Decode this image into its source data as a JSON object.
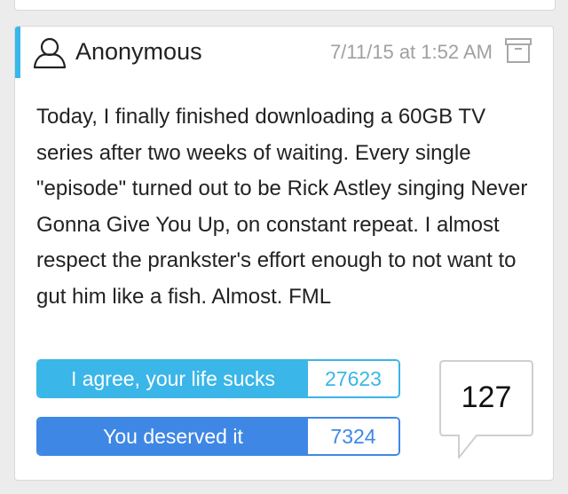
{
  "post": {
    "author": "Anonymous",
    "timestamp": "7/11/15 at 1:52 AM",
    "text": "Today, I finally finished downloading a 60GB TV series after two weeks of waiting. Every single \"episode\" turned out to be Rick Astley singing Never Gonna Give You Up, on constant repeat. I almost respect the prankster's effort enough to not want to gut him like a fish. Almost. FML"
  },
  "votes": {
    "agree_label": "I agree, your life sucks",
    "agree_count": "27623",
    "deserve_label": "You deserved it",
    "deserve_count": "7324"
  },
  "comments": {
    "count": "127"
  },
  "icons": {
    "user": "user-icon",
    "archive": "archive-icon",
    "comment": "comment-bubble-icon"
  },
  "colors": {
    "accent": "#38b7ea",
    "agree": "#3ab6e8",
    "deserve": "#3f87e5"
  }
}
